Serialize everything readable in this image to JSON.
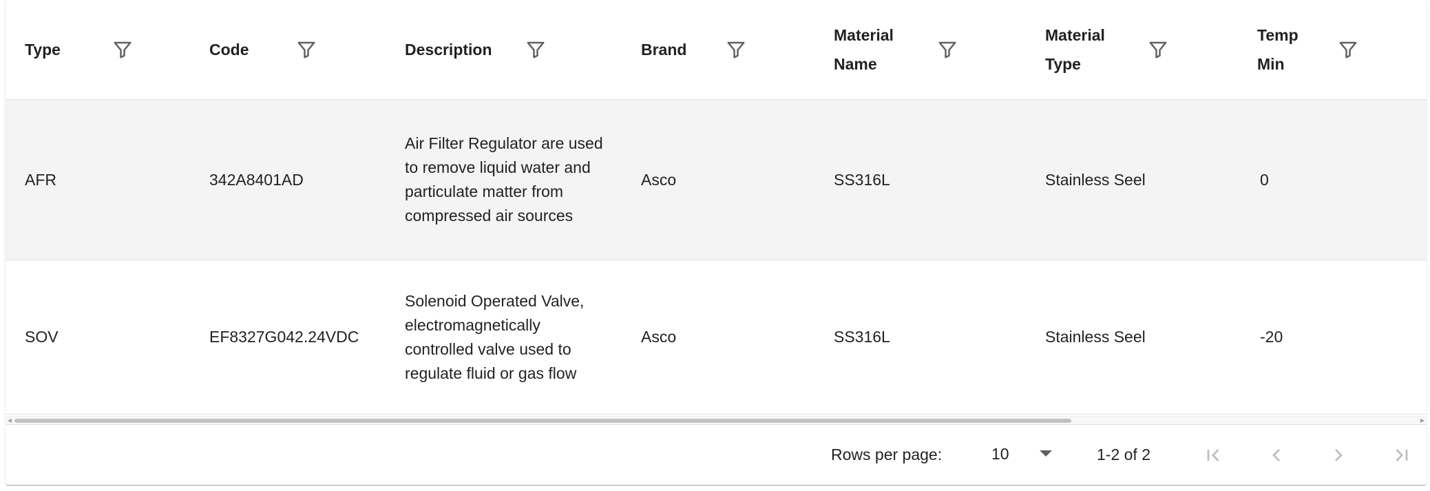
{
  "table": {
    "columns": [
      {
        "label": "Type"
      },
      {
        "label": "Code"
      },
      {
        "label": "Description"
      },
      {
        "label": "Brand"
      },
      {
        "label": "Material Name"
      },
      {
        "label": "Material Type"
      },
      {
        "label": "Temp Min"
      }
    ],
    "rows": [
      {
        "type": "AFR",
        "code": "342A8401AD",
        "description": "Air Filter Regulator are used to remove liquid water and particulate matter from compressed air sources",
        "brand": "Asco",
        "material_name": "SS316L",
        "material_type": "Stainless Seel",
        "temp_min": "0"
      },
      {
        "type": "SOV",
        "code": "EF8327G042.24VDC",
        "description": "Solenoid Operated Valve, electromagnetically controlled valve used to regulate fluid or gas flow",
        "brand": "Asco",
        "material_name": "SS316L",
        "material_type": "Stainless Seel",
        "temp_min": "-20"
      }
    ]
  },
  "pagination": {
    "rows_per_page_label": "Rows per page:",
    "rows_per_page_value": "10",
    "range_text": "1-2 of 2"
  },
  "icons": {
    "filter": "filter-icon",
    "first_page": "first-page-icon",
    "prev_page": "chevron-left-icon",
    "next_page": "chevron-right-icon",
    "last_page": "last-page-icon",
    "dropdown": "arrow-drop-down-icon"
  },
  "colors": {
    "header_text": "#212121",
    "row_alt_bg": "#f4f4f4",
    "icon": "#616161",
    "disabled_icon": "#bdbdbd",
    "divider": "#e0e0e0"
  }
}
